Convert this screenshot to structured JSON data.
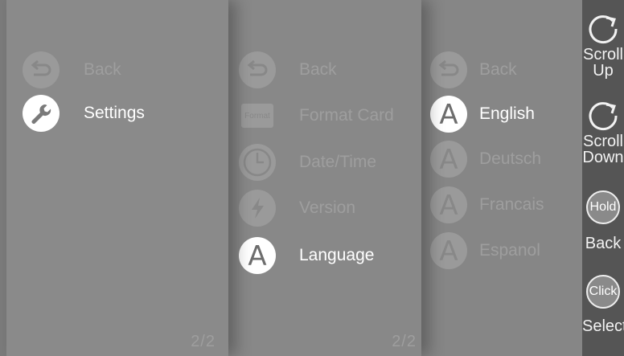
{
  "panels": {
    "main": {
      "items": [
        {
          "label": "Back",
          "icon": "back-arrow-icon",
          "state": "dim"
        },
        {
          "label": "Settings",
          "icon": "wrench-icon",
          "state": "selected"
        }
      ],
      "page_indicator": "2/2"
    },
    "settings": {
      "items": [
        {
          "label": "Back",
          "icon": "back-arrow-icon",
          "state": "dim"
        },
        {
          "label": "Format Card",
          "icon": "format-card-icon",
          "icon_text": "Format",
          "state": "dim"
        },
        {
          "label": "Date/Time",
          "icon": "clock-icon",
          "state": "dim"
        },
        {
          "label": "Version",
          "icon": "lightning-icon",
          "state": "dim"
        },
        {
          "label": "Language",
          "icon": "letter-a-icon",
          "icon_text": "A",
          "state": "selected"
        }
      ],
      "page_indicator": "2/2"
    },
    "language": {
      "items": [
        {
          "label": "Back",
          "icon": "back-arrow-icon",
          "state": "dim"
        },
        {
          "label": "English",
          "icon": "letter-a-icon",
          "icon_text": "A",
          "state": "selected"
        },
        {
          "label": "Deutsch",
          "icon": "letter-a-icon",
          "icon_text": "A",
          "state": "dim"
        },
        {
          "label": "Francais",
          "icon": "letter-a-icon",
          "icon_text": "A",
          "state": "dim"
        },
        {
          "label": "Espanol",
          "icon": "letter-a-icon",
          "icon_text": "A",
          "state": "dim"
        }
      ]
    }
  },
  "controls": {
    "scroll_up": {
      "label": "Scroll\nUp",
      "icon": "rotate-icon"
    },
    "scroll_down": {
      "label": "Scroll\nDown",
      "icon": "rotate-icon"
    },
    "back": {
      "label": "Back",
      "icon_text": "Hold"
    },
    "select": {
      "label": "Select",
      "icon_text": "Click"
    }
  },
  "colors": {
    "background": "#7b7b7b",
    "control_bar": "#555555",
    "selected_text": "#ffffff",
    "dim_text": "#9e9e9e"
  }
}
